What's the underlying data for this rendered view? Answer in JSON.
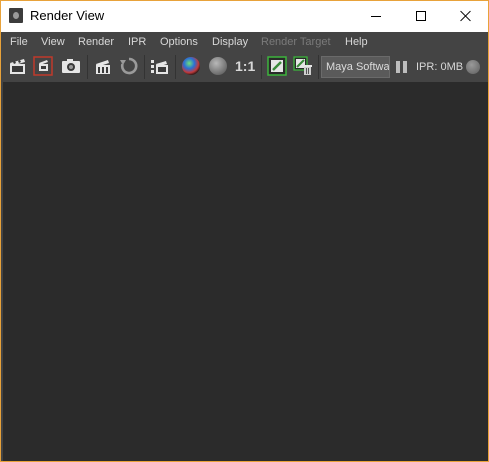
{
  "window": {
    "title": "Render View",
    "controls": [
      "minimize",
      "maximize",
      "close"
    ]
  },
  "menu": {
    "items": [
      {
        "label": "File",
        "enabled": true
      },
      {
        "label": "View",
        "enabled": true
      },
      {
        "label": "Render",
        "enabled": true
      },
      {
        "label": "IPR",
        "enabled": true
      },
      {
        "label": "Options",
        "enabled": true
      },
      {
        "label": "Display",
        "enabled": true
      },
      {
        "label": "Render Target",
        "enabled": false
      },
      {
        "label": "Help",
        "enabled": true
      }
    ]
  },
  "toolbar": {
    "icons": [
      "redo-render-icon",
      "render-region-icon",
      "snapshot-camera-icon",
      "ipr-render-icon",
      "refresh-ipr-icon",
      "render-sequence-icon",
      "rgb-channels-icon",
      "alpha-channel-icon",
      "real-size-label",
      "keep-image-icon",
      "remove-image-icon"
    ],
    "ratio_label": "1:1",
    "renderer": "Maya Software",
    "renderer_visible": "Maya Softwa",
    "ipr_memory": "IPR: 0MB"
  },
  "colors": {
    "window_border": "#e8a23a",
    "chrome_bg": "#444444",
    "canvas_bg": "#2b2b2b",
    "region_highlight": "#c0392b",
    "keep_image_accent": "#3cb33c"
  }
}
